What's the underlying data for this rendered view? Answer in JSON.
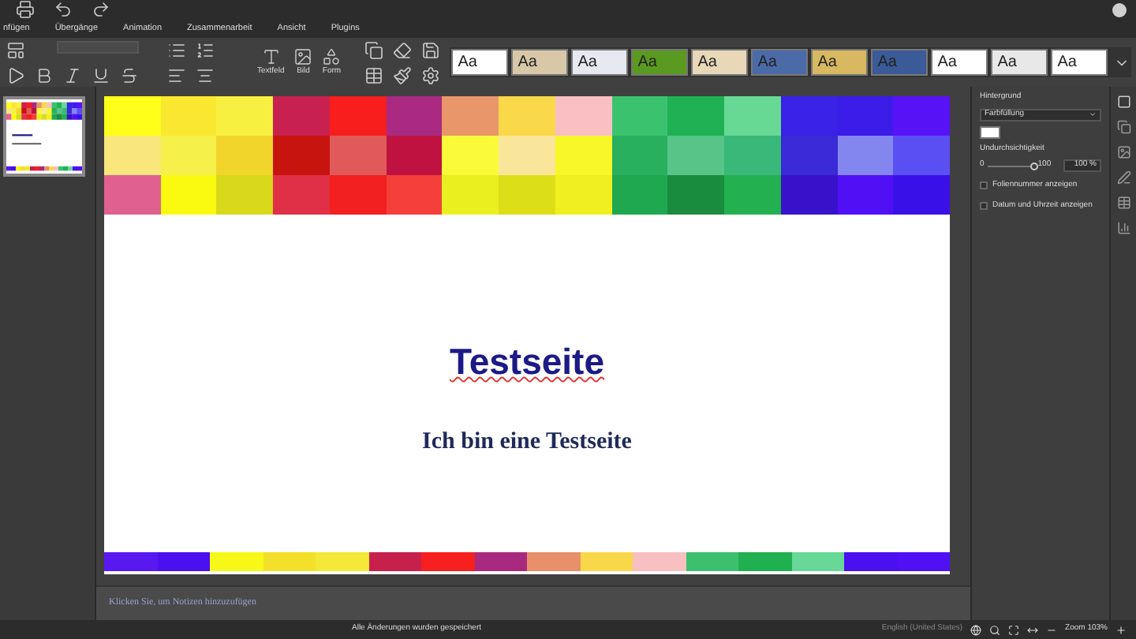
{
  "menu": [
    {
      "label": "nfügen",
      "selected": false
    },
    {
      "label": "Übergänge",
      "selected": false
    },
    {
      "label": "Animation",
      "selected": false
    },
    {
      "label": "Zusammenarbeit",
      "selected": false
    },
    {
      "label": "Ansicht",
      "selected": false
    },
    {
      "label": "Plugins",
      "selected": false
    }
  ],
  "toolbar": {
    "buttons": [
      {
        "label": "Textfeld",
        "kind": "text"
      },
      {
        "label": "Bild",
        "kind": "image"
      },
      {
        "label": "Form",
        "kind": "shape"
      }
    ]
  },
  "themes": [
    {
      "label": "Aa",
      "color": "#ffffff"
    },
    {
      "label": "Aa",
      "color": "#d8c8a8"
    },
    {
      "label": "Aa",
      "color": "#e8e8f0"
    },
    {
      "label": "Aa",
      "color": "#5a9a20"
    },
    {
      "label": "Aa",
      "color": "#e8d8b8"
    },
    {
      "label": "Aa",
      "color": "#4a6aa8"
    },
    {
      "label": "Aa",
      "color": "#d8b860"
    },
    {
      "label": "Aa",
      "color": "#3a5a98"
    },
    {
      "label": "Aa",
      "color": "#ffffff"
    },
    {
      "label": "Aa",
      "color": "#e8e8e8"
    },
    {
      "label": "Aa",
      "color": "#ffffff"
    }
  ],
  "thumbnails": [
    {
      "selected": true
    }
  ],
  "slide": {
    "title": "Testseite",
    "subtitle": "Ich bin eine Testseite",
    "top_rows": [
      [
        {
          "color": "#ffff1a"
        },
        {
          "color": "#f9e82f"
        },
        {
          "color": "#f8f040"
        },
        {
          "color": "#c8214f"
        },
        {
          "color": "#f81e1e"
        },
        {
          "color": "#a92a80"
        },
        {
          "color": "#e8966a"
        },
        {
          "color": "#f9d84a"
        },
        {
          "color": "#f9bfc3"
        },
        {
          "color": "#3bc26f"
        },
        {
          "color": "#1fb153"
        },
        {
          "color": "#67d994"
        },
        {
          "color": "#3a22e6"
        },
        {
          "color": "#3c1ce9"
        },
        {
          "color": "#5812f6"
        }
      ],
      [
        {
          "color": "#f9e67c"
        },
        {
          "color": "#f5f04a"
        },
        {
          "color": "#f1d52a"
        },
        {
          "color": "#c8140e"
        },
        {
          "color": "#e05a5a"
        },
        {
          "color": "#bf1240"
        },
        {
          "color": "#fafa3a"
        },
        {
          "color": "#fae69a"
        },
        {
          "color": "#f7f72a"
        },
        {
          "color": "#28b05e"
        },
        {
          "color": "#57c488"
        },
        {
          "color": "#3ab87a"
        },
        {
          "color": "#3a2ad8"
        },
        {
          "color": "#8486f0"
        },
        {
          "color": "#5a4ff2"
        }
      ],
      [
        {
          "color": "#e06090"
        },
        {
          "color": "#fafa10"
        },
        {
          "color": "#d9d81a"
        },
        {
          "color": "#e03048"
        },
        {
          "color": "#f22020"
        },
        {
          "color": "#f43f3a"
        },
        {
          "color": "#e8f020"
        },
        {
          "color": "#dcdf18"
        },
        {
          "color": "#f0f020"
        },
        {
          "color": "#20a850"
        },
        {
          "color": "#1a8c3e"
        },
        {
          "color": "#22b050"
        },
        {
          "color": "#3812c8"
        },
        {
          "color": "#5010f5"
        },
        {
          "color": "#3a10e8"
        }
      ]
    ],
    "bottom_row": [
      {
        "color": "#5a18f0"
      },
      {
        "color": "#4a10f0"
      },
      {
        "color": "#f8f818"
      },
      {
        "color": "#f4e02a"
      },
      {
        "color": "#f4e838"
      },
      {
        "color": "#c8204c"
      },
      {
        "color": "#f62020"
      },
      {
        "color": "#a82a7e"
      },
      {
        "color": "#e8906a"
      },
      {
        "color": "#f8d84a"
      },
      {
        "color": "#f8c0c0"
      },
      {
        "color": "#3cc070"
      },
      {
        "color": "#20b050"
      },
      {
        "color": "#68d898"
      },
      {
        "color": "#4a10f0"
      },
      {
        "color": "#5010f5"
      }
    ]
  },
  "notes": {
    "placeholder": "Klicken Sie, um Notizen hinzuzufügen"
  },
  "panel": {
    "heading": "Hintergrund",
    "fill": "Farbfüllung",
    "swatch": {
      "color": "#ffffff"
    },
    "opacity_label": "Undurchsichtigkeit",
    "slider": {
      "min": "0",
      "max": "100",
      "level": 1
    },
    "opacity_value": "100 %",
    "checkboxes": [
      {
        "label": "Foliennummer anzeigen",
        "checked": false
      },
      {
        "label": "Datum und Uhrzeit anzeigen",
        "checked": false
      }
    ]
  },
  "status": {
    "saved": "Alle Änderungen wurden gespeichert",
    "language": "English (United States)",
    "zoom": "Zoom 103%"
  }
}
